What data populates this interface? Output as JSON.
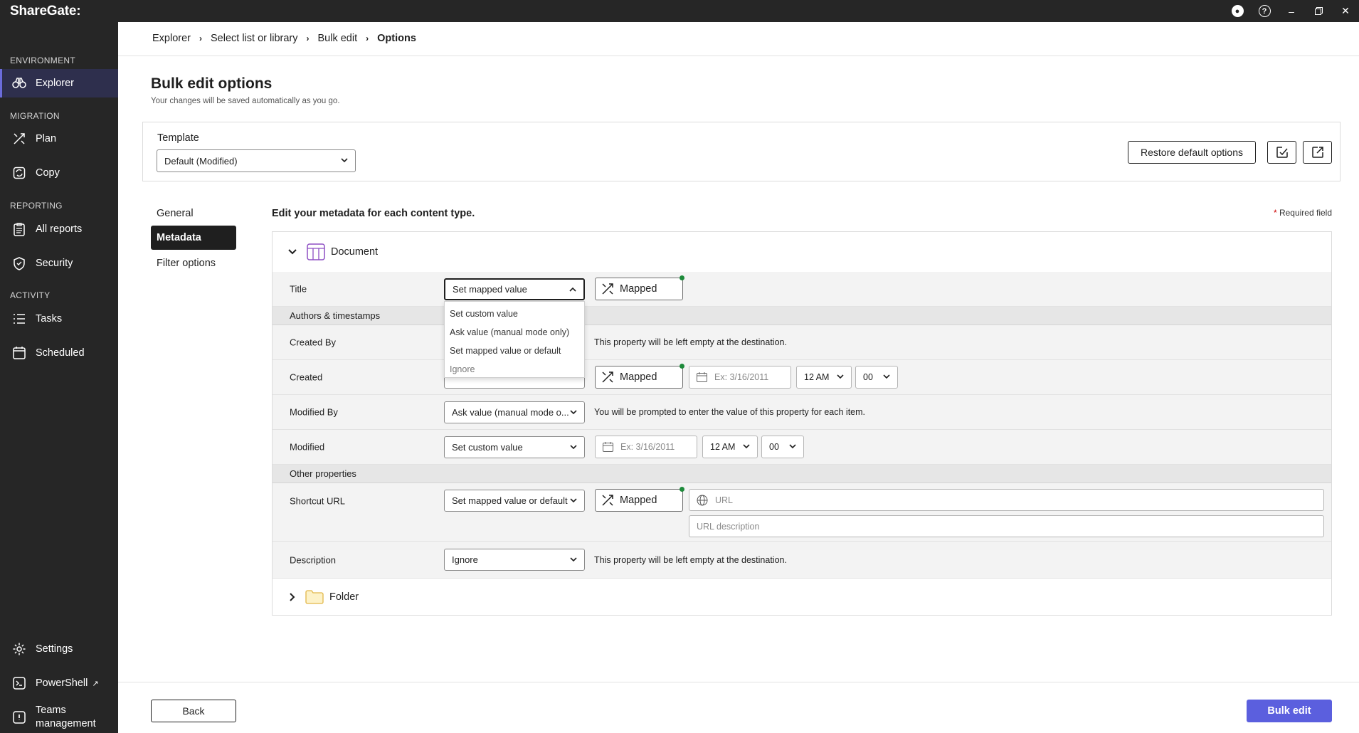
{
  "app": {
    "brand": "ShareGate:"
  },
  "sidebar": {
    "sections": {
      "environment": "ENVIRONMENT",
      "migration": "MIGRATION",
      "reporting": "REPORTING",
      "activity": "ACTIVITY"
    },
    "items": [
      {
        "label": "Explorer",
        "icon": "binoculars-icon"
      },
      {
        "label": "Plan",
        "icon": "plan-icon"
      },
      {
        "label": "Copy",
        "icon": "copy-icon"
      },
      {
        "label": "All reports",
        "icon": "reports-icon"
      },
      {
        "label": "Security",
        "icon": "shield-icon"
      },
      {
        "label": "Tasks",
        "icon": "tasks-icon"
      },
      {
        "label": "Scheduled",
        "icon": "calendar-icon"
      },
      {
        "label": "Settings",
        "icon": "gear-icon"
      },
      {
        "label": "PowerShell",
        "icon": "terminal-icon"
      },
      {
        "label_line1": "Teams",
        "label_line2": "management",
        "icon": "teams-icon"
      }
    ],
    "active_item": "Explorer"
  },
  "breadcrumb": [
    "Explorer",
    "Select list or library",
    "Bulk edit",
    "Options"
  ],
  "header": {
    "title": "Bulk edit options",
    "subtitle": "Your changes will be saved automatically as you go."
  },
  "template": {
    "label": "Template",
    "value": "Default (Modified)",
    "restore_label": "Restore default options"
  },
  "tabs": [
    "General",
    "Metadata",
    "Filter options"
  ],
  "active_tab": "Metadata",
  "metadata": {
    "heading": "Edit your metadata for each content type.",
    "required_star": "*",
    "required_label": "Required field",
    "content_types": [
      "Document",
      "Folder"
    ],
    "mapped_label": "Mapped",
    "date_placeholder": "Ex: 3/16/2011",
    "hour_value": "12 AM",
    "minute_value": "00",
    "url_placeholder": "URL",
    "url_desc_placeholder": "URL description",
    "groups": {
      "authors": "Authors & timestamps",
      "other": "Other properties"
    },
    "rows": {
      "title": {
        "label": "Title",
        "value": "Set mapped value"
      },
      "created_by": {
        "label": "Created By",
        "help": "This property will be left empty at the destination."
      },
      "created": {
        "label": "Created"
      },
      "modified_by": {
        "label": "Modified By",
        "value": "Ask value (manual mode o...",
        "help": "You will be prompted to enter the value of this property for each item."
      },
      "modified": {
        "label": "Modified",
        "value": "Set custom value"
      },
      "shortcut_url": {
        "label": "Shortcut URL",
        "value": "Set mapped value or default"
      },
      "description": {
        "label": "Description",
        "value": "Ignore",
        "help": "This property will be left empty at the destination."
      }
    }
  },
  "dropdown": {
    "options": [
      "Set custom value",
      "Ask value (manual mode only)",
      "Set mapped value or default",
      "Ignore"
    ]
  },
  "footer": {
    "back_label": "Back",
    "submit_label": "Bulk edit"
  },
  "colors": {
    "sidebar_bg": "#262626",
    "accent": "#5b5fde",
    "mapped_dot": "#1d8a3a"
  }
}
